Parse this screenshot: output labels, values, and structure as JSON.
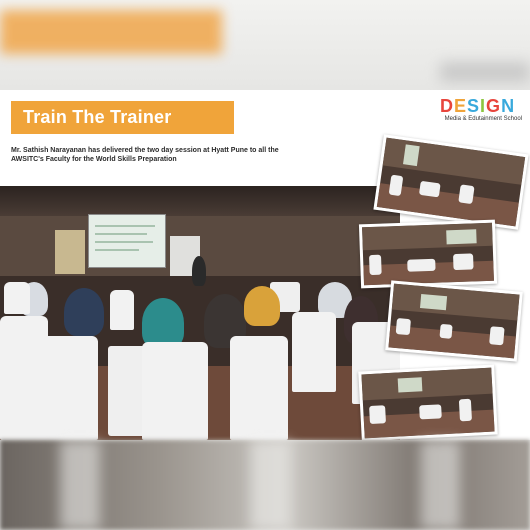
{
  "header": {
    "title": "Train The Trainer"
  },
  "logo": {
    "letters": [
      {
        "char": "D",
        "color": "#e8453c"
      },
      {
        "char": "E",
        "color": "#f0a43a"
      },
      {
        "char": "S",
        "color": "#39a9dc"
      },
      {
        "char": "I",
        "color": "#8dc63f"
      },
      {
        "char": "G",
        "color": "#e8453c"
      },
      {
        "char": "N",
        "color": "#39a9dc"
      }
    ],
    "tagline": "Media & Edutainment School"
  },
  "caption": {
    "line1": "Mr. Sathish Narayanan has delivered the two day session at Hyatt Pune to all the",
    "line2": "AWSITC's Faculty  for the World Skills Preparation"
  },
  "colors": {
    "accent": "#f0a43a",
    "title_text": "#ffffff"
  },
  "photos": {
    "main": "conference-room-photo",
    "thumbnails": [
      "thumb-photo-1",
      "thumb-photo-2",
      "thumb-photo-3",
      "thumb-photo-4"
    ]
  }
}
